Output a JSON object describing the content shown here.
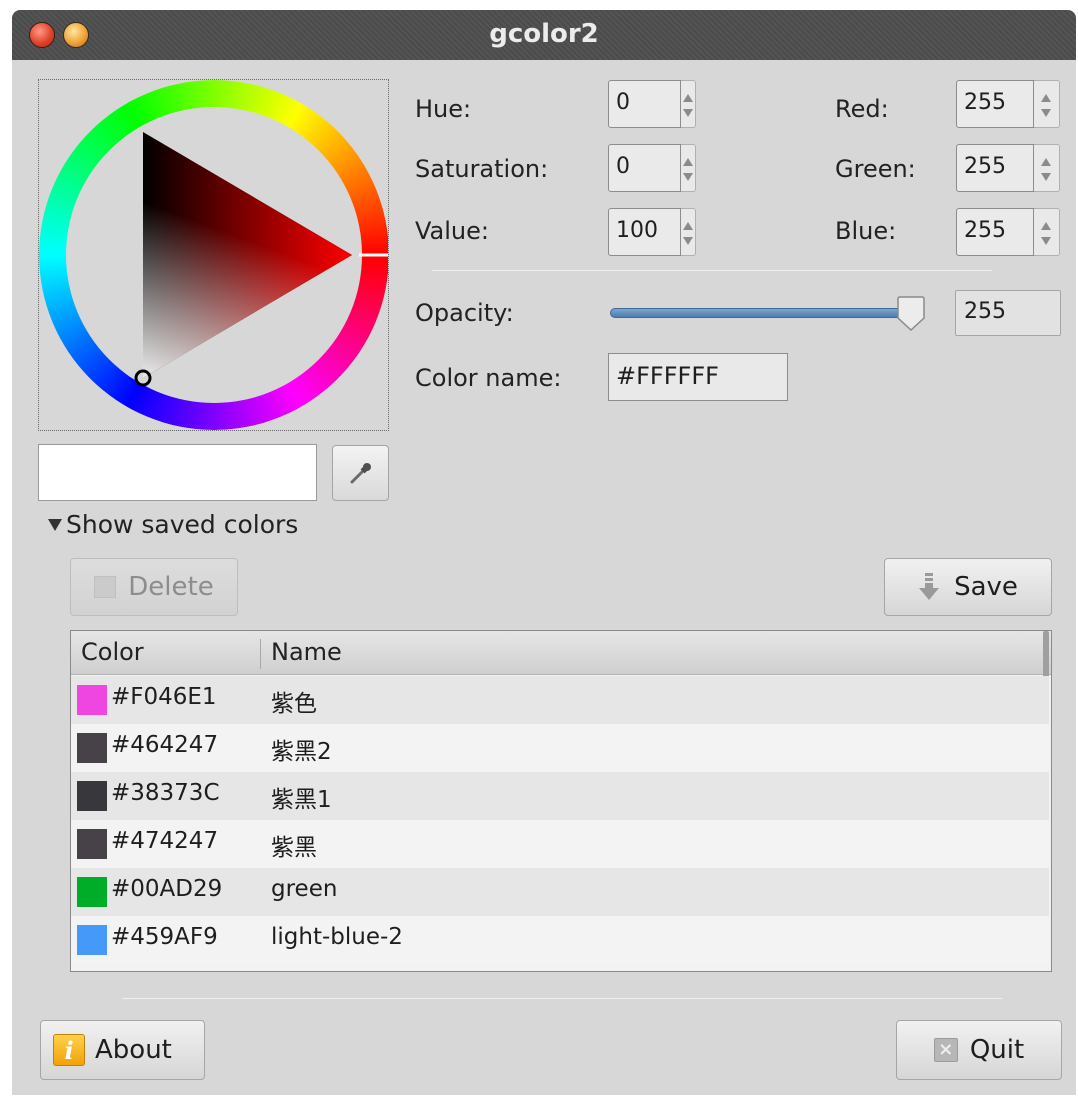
{
  "window": {
    "title": "gcolor2"
  },
  "hsv": {
    "hue_label": "Hue:",
    "hue_value": "0",
    "saturation_label": "Saturation:",
    "saturation_value": "0",
    "value_label": "Value:",
    "value_value": "100"
  },
  "rgb": {
    "red_label": "Red:",
    "red_value": "255",
    "green_label": "Green:",
    "green_value": "255",
    "blue_label": "Blue:",
    "blue_value": "255"
  },
  "opacity": {
    "label": "Opacity:",
    "value": "255",
    "fraction": 1.0
  },
  "color_name": {
    "label": "Color name:",
    "value": "#FFFFFF"
  },
  "current_color": "#FFFFFF",
  "saved_colors": {
    "expander_label": "Show saved colors",
    "delete_label": "Delete",
    "save_label": "Save",
    "columns": [
      "Color",
      "Name"
    ],
    "rows": [
      {
        "hex": "#F046E1",
        "name": "紫色",
        "swatch": "#F046E1"
      },
      {
        "hex": "#464247",
        "name": "紫黑2",
        "swatch": "#464247"
      },
      {
        "hex": "#38373C",
        "name": "紫黑1",
        "swatch": "#38373C"
      },
      {
        "hex": "#474247",
        "name": "紫黑",
        "swatch": "#474247"
      },
      {
        "hex": "#00AD29",
        "name": "green",
        "swatch": "#00AD29"
      },
      {
        "hex": "#459AF9",
        "name": "light-blue-2",
        "swatch": "#459AF9"
      }
    ]
  },
  "footer": {
    "about_label": "About",
    "quit_label": "Quit"
  },
  "icons": {
    "close": "close-icon",
    "minimize": "minimize-icon",
    "picker": "eyedropper-icon",
    "delete": "delete-icon",
    "save": "save-arrow-icon",
    "about": "info-icon",
    "quit": "quit-icon"
  }
}
